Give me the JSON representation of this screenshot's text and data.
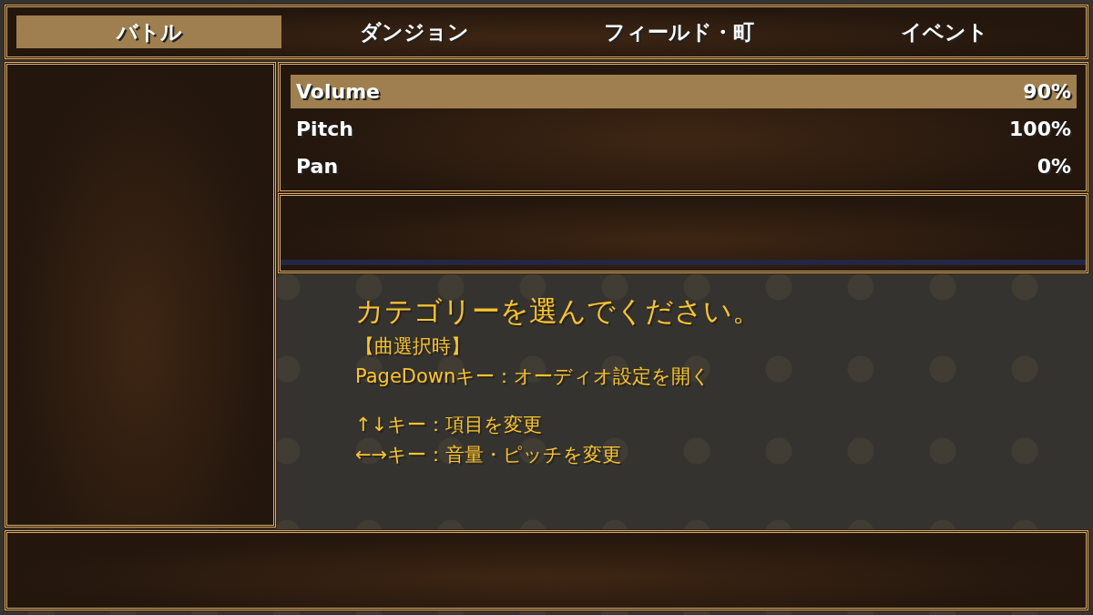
{
  "tabs": [
    {
      "label": "バトル",
      "selected": true
    },
    {
      "label": "ダンジョン",
      "selected": false
    },
    {
      "label": "フィールド・町",
      "selected": false
    },
    {
      "label": "イベント",
      "selected": false
    }
  ],
  "settings": [
    {
      "name": "Volume",
      "value": "90%",
      "selected": true
    },
    {
      "name": "Pitch",
      "value": "100%",
      "selected": false
    },
    {
      "name": "Pan",
      "value": "0%",
      "selected": false
    }
  ],
  "help": {
    "title": "カテゴリーを選んでください。",
    "groups": [
      [
        "【曲選択時】",
        "PageDownキー：オーディオ設定を開く"
      ],
      [
        "↑↓キー：項目を変更",
        "←→キー：音量・ピッチを変更"
      ]
    ]
  }
}
